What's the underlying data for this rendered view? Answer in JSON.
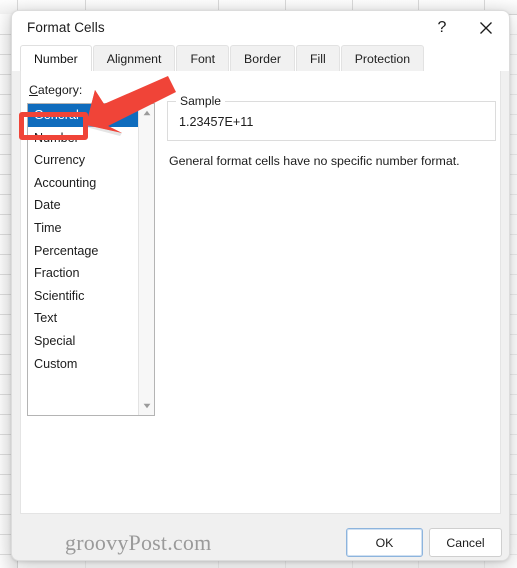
{
  "window": {
    "title": "Format Cells",
    "help_icon": "question-mark-icon",
    "help_label": "?",
    "close_icon": "close-icon"
  },
  "tabs": [
    {
      "label": "Number",
      "active": true
    },
    {
      "label": "Alignment",
      "active": false
    },
    {
      "label": "Font",
      "active": false
    },
    {
      "label": "Border",
      "active": false
    },
    {
      "label": "Fill",
      "active": false
    },
    {
      "label": "Protection",
      "active": false
    }
  ],
  "category": {
    "label": "Category:",
    "label_accel": "C",
    "label_rest": "ategory:",
    "selected": "General",
    "items": [
      "General",
      "Number",
      "Currency",
      "Accounting",
      "Date",
      "Time",
      "Percentage",
      "Fraction",
      "Scientific",
      "Text",
      "Special",
      "Custom"
    ],
    "scrollbar": {
      "up_icon": "scroll-up-arrow-icon",
      "down_icon": "scroll-down-arrow-icon"
    }
  },
  "sample": {
    "group_title": "Sample",
    "value": "1.23457E+11"
  },
  "description": "General format cells have no specific number format.",
  "footer": {
    "watermark": "groovyPost.com",
    "ok_label": "OK",
    "cancel_label": "Cancel"
  },
  "annotations": {
    "arrow_color": "#f04438",
    "highlight_color": "#f04438",
    "highlight_target": "Number",
    "arrow_icon": "red-arrow-pointing-down-left"
  },
  "colors": {
    "selection_blue": "#0f6cbd",
    "accent_red": "#f04438",
    "dialog_bg": "#f0f0f0",
    "content_bg": "#ffffff"
  }
}
